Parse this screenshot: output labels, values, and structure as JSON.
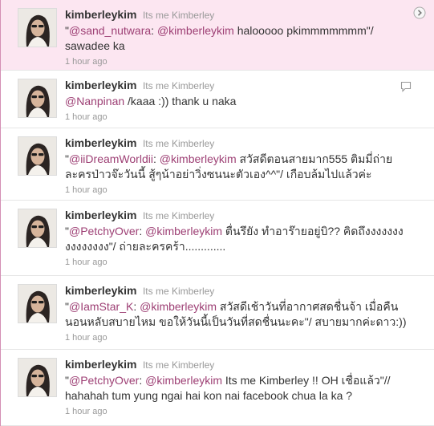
{
  "tweets": [
    {
      "screen_name": "kimberleykim",
      "full_name": "Its me Kimberley",
      "parts": [
        {
          "text": "\"",
          "mention": false
        },
        {
          "text": "@sand_nutwara",
          "mention": true
        },
        {
          "text": ": ",
          "mention": false
        },
        {
          "text": "@kimberleykim",
          "mention": true
        },
        {
          "text": " halooooo pkimmmmmmm\"/ sawadee ka",
          "mention": false
        }
      ],
      "time": "1 hour ago"
    },
    {
      "screen_name": "kimberleykim",
      "full_name": "Its me Kimberley",
      "parts": [
        {
          "text": "@Nanpinan",
          "mention": true
        },
        {
          "text": " /kaaa :)) thank u naka",
          "mention": false
        }
      ],
      "time": "1 hour ago"
    },
    {
      "screen_name": "kimberleykim",
      "full_name": "Its me Kimberley",
      "parts": [
        {
          "text": "\"",
          "mention": false
        },
        {
          "text": "@iiDreamWorldii",
          "mention": true
        },
        {
          "text": ": ",
          "mention": false
        },
        {
          "text": "@kimberleykim",
          "mention": true
        },
        {
          "text": " สวัสดีตอนสายมาก555 ติมมี่ถ่ายละครป่าวจ๊ะวันนี้ สู้ๆน้าอย่าวิ่งซนนะตัวเอง^^\"/ เกือบล้มไปแล้วค่ะ",
          "mention": false
        }
      ],
      "time": "1 hour ago"
    },
    {
      "screen_name": "kimberleykim",
      "full_name": "Its me Kimberley",
      "parts": [
        {
          "text": "\"",
          "mention": false
        },
        {
          "text": "@PetchyOver",
          "mention": true
        },
        {
          "text": ": ",
          "mention": false
        },
        {
          "text": "@kimberleykim",
          "mention": true
        },
        {
          "text": " ตื่นรึยัง ทำอาร๊ายอยู่บิ?? คิดถึงงงงงงงงงงงงงงง\"/ ถ่ายละครคร้า.............",
          "mention": false
        }
      ],
      "time": "1 hour ago"
    },
    {
      "screen_name": "kimberleykim",
      "full_name": "Its me Kimberley",
      "parts": [
        {
          "text": "\"",
          "mention": false
        },
        {
          "text": "@IamStar_K",
          "mention": true
        },
        {
          "text": ": ",
          "mention": false
        },
        {
          "text": "@kimberleykim",
          "mention": true
        },
        {
          "text": " สวัสดีเช้าวันที่อากาศสดชื่นจ้า เมื่อคืนนอนหลับสบายไหม ขอให้วันนี้เป็นวันที่สดชื่นนะคะ\"/ สบายมากค่ะดาว:))",
          "mention": false
        }
      ],
      "time": "1 hour ago"
    },
    {
      "screen_name": "kimberleykim",
      "full_name": "Its me Kimberley",
      "parts": [
        {
          "text": "\"",
          "mention": false
        },
        {
          "text": "@PetchyOver",
          "mention": true
        },
        {
          "text": ": ",
          "mention": false
        },
        {
          "text": "@kimberleykim",
          "mention": true
        },
        {
          "text": " Its me Kimberley !! OH เชื่อแล้ว\"// hahahah tum yung ngai hai kon nai facebook chua la ka ?",
          "mention": false
        }
      ],
      "time": "1 hour ago"
    }
  ]
}
